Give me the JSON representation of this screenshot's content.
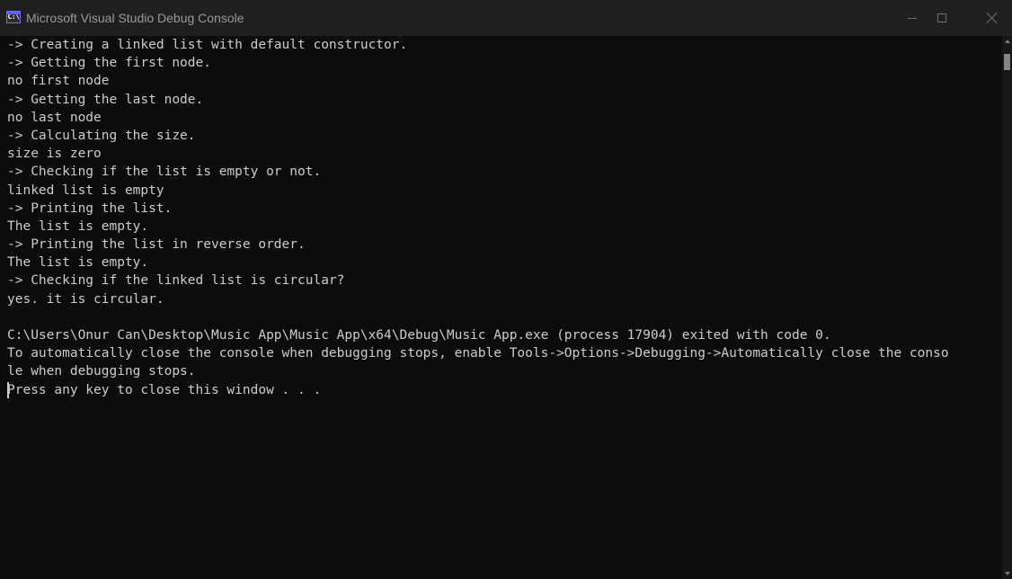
{
  "window": {
    "title": "Microsoft Visual Studio Debug Console",
    "icon_text": "C:\\"
  },
  "console": {
    "lines": [
      "-> Creating a linked list with default constructor.",
      "-> Getting the first node.",
      "no first node",
      "-> Getting the last node.",
      "no last node",
      "-> Calculating the size.",
      "size is zero",
      "-> Checking if the list is empty or not.",
      "linked list is empty",
      "-> Printing the list.",
      "The list is empty.",
      "-> Printing the list in reverse order.",
      "The list is empty.",
      "-> Checking if the linked list is circular?",
      "yes. it is circular.",
      "",
      "C:\\Users\\Onur Can\\Desktop\\Music App\\Music App\\x64\\Debug\\Music App.exe (process 17904) exited with code 0.",
      "To automatically close the console when debugging stops, enable Tools->Options->Debugging->Automatically close the conso",
      "le when debugging stops.",
      "Press any key to close this window . . ."
    ]
  },
  "icons": {
    "app": "console-app-icon",
    "minimize": "minimize-icon",
    "maximize": "maximize-icon",
    "close": "close-icon"
  },
  "colors": {
    "background": "#0c0c0c",
    "titlebar": "#1f1f1f",
    "text": "#cccccc"
  }
}
